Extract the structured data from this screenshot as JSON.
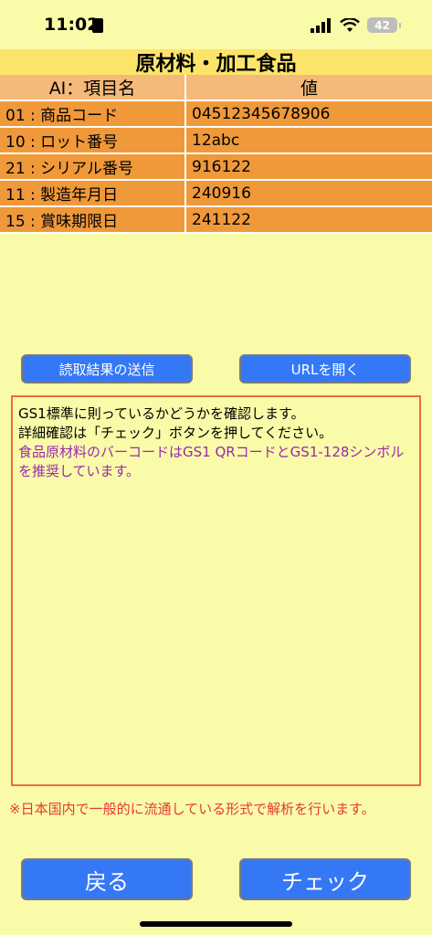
{
  "status": {
    "time": "11:02",
    "battery": "42"
  },
  "title": "原材料・加工食品",
  "table": {
    "headers": [
      "AI：項目名",
      "値"
    ],
    "rows": [
      [
        "01 : 商品コード",
        "04512345678906"
      ],
      [
        "10 : ロット番号",
        "12abc"
      ],
      [
        "21 : シリアル番号",
        "916122"
      ],
      [
        "11 : 製造年月日",
        "240916"
      ],
      [
        "15 : 賞味期限日",
        "241122"
      ]
    ]
  },
  "buttons": {
    "send": "読取結果の送信",
    "open_url": "URLを開く",
    "back": "戻る",
    "check": "チェック"
  },
  "message": {
    "line1": "GS1標準に則っているかどうかを確認します。",
    "line2": "詳細確認は「チェック」ボタンを押してください。",
    "line3": "食品原材料のバーコードはGS1 QRコードとGS1-128シンボルを推奨しています。"
  },
  "note": "※日本国内で一般的に流通している形式で解析を行います。",
  "colors": {
    "background": "#fafba8",
    "title": "#fce46a",
    "header": "#f5b979",
    "row": "#f0993a",
    "button": "#3478f6",
    "purple_text": "#9b27b0",
    "note_text": "#e53935"
  }
}
